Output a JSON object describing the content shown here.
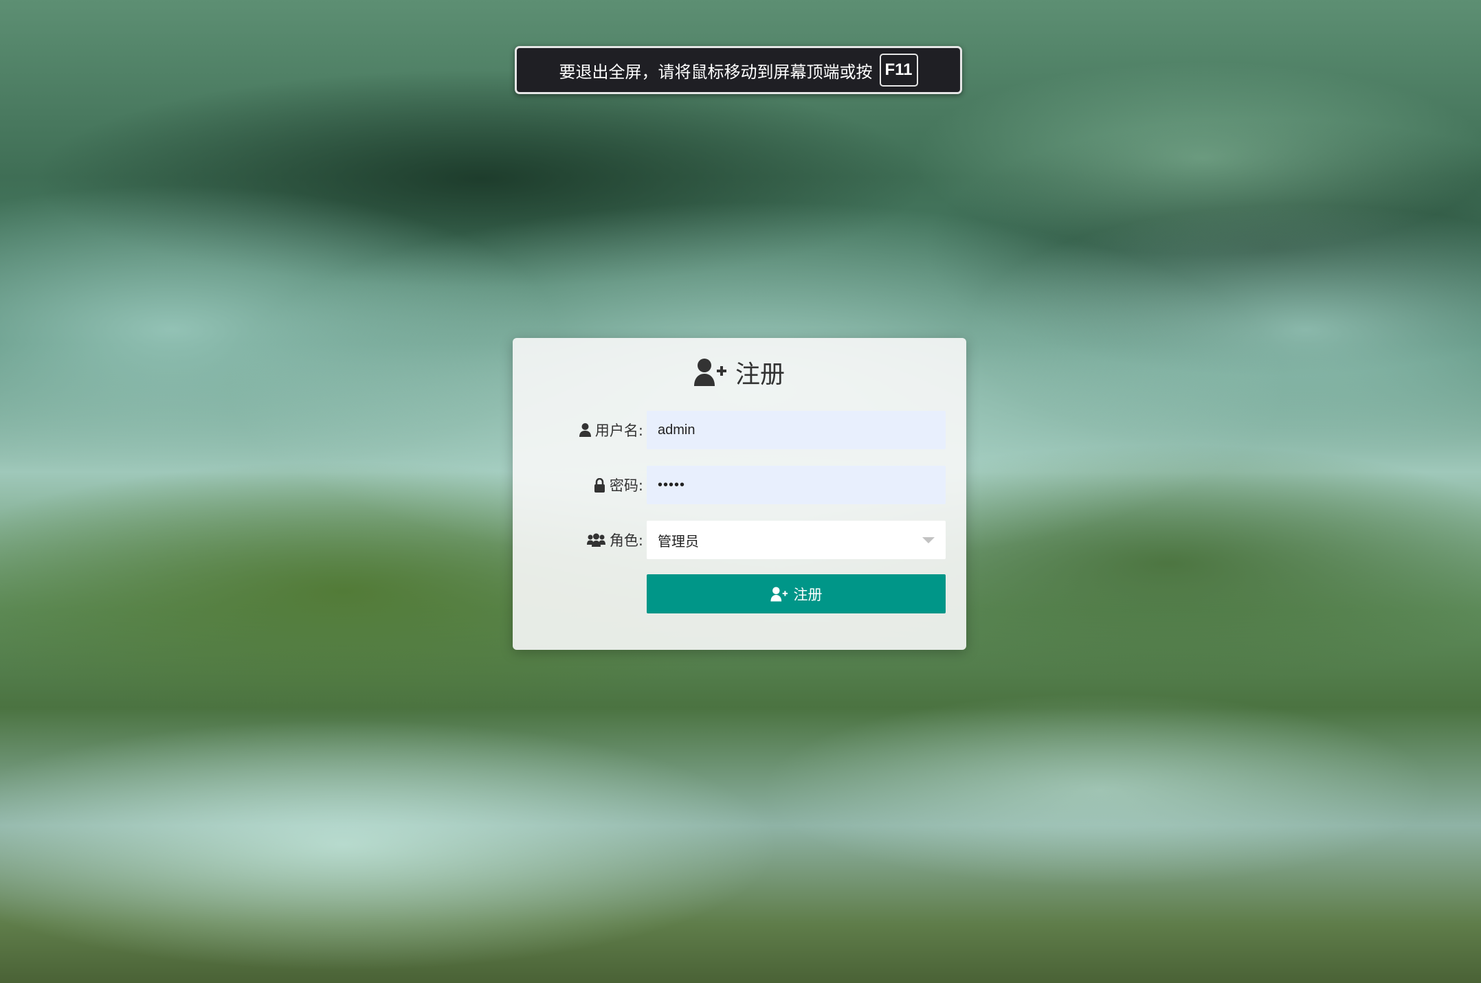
{
  "fullscreen_notice": {
    "message": "要退出全屏，请将鼠标移动到屏幕顶端或按",
    "key": "F11"
  },
  "register_form": {
    "title": "注册",
    "title_icon": "user-plus-icon",
    "fields": {
      "username": {
        "label": "用户名:",
        "icon": "user-icon",
        "value": "admin"
      },
      "password": {
        "label": "密码:",
        "icon": "lock-icon",
        "value": "•••••"
      },
      "role": {
        "label": "角色:",
        "icon": "users-icon",
        "selected": "管理员"
      }
    },
    "submit": {
      "label": "注册",
      "icon": "user-plus-icon"
    }
  },
  "colors": {
    "primary": "#009688",
    "input_autofill_bg": "#e8effd",
    "toast_bg": "#1f1f24",
    "card_bg": "#f7f7f7",
    "text": "#333333"
  }
}
